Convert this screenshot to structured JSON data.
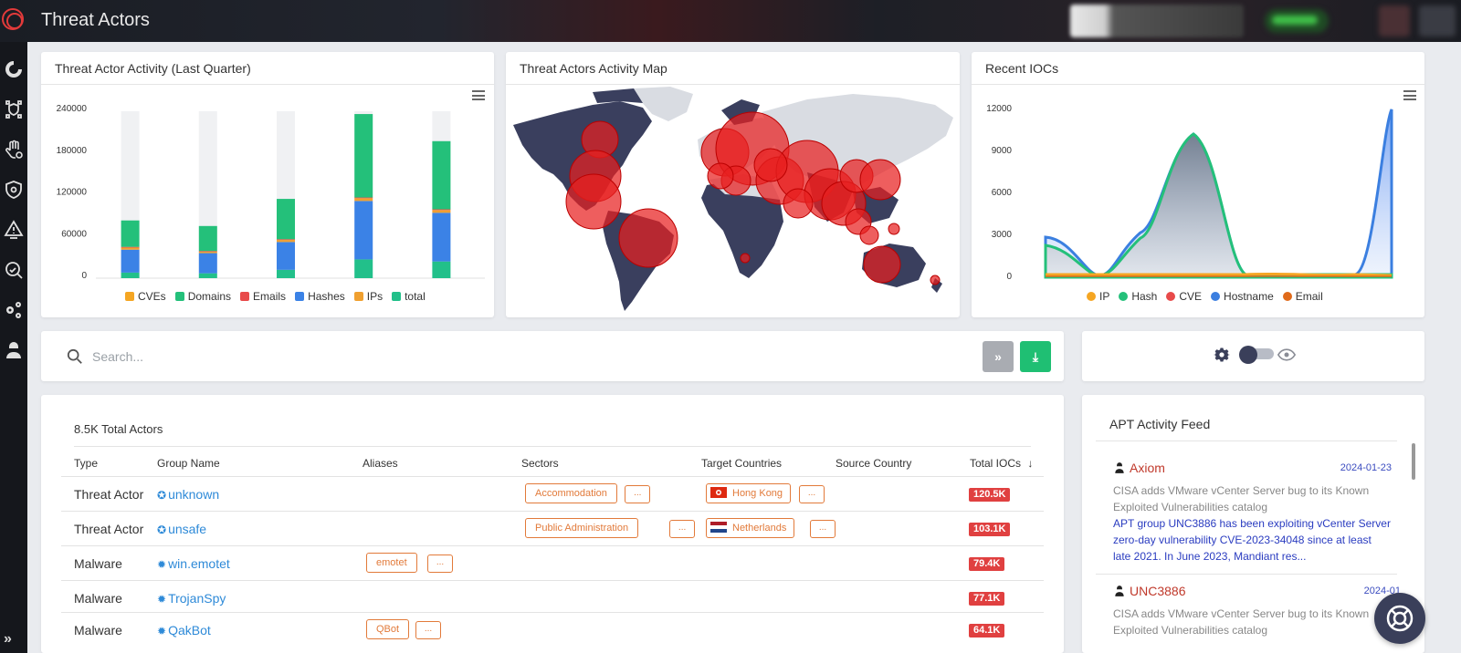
{
  "app": {
    "title": "Threat Actors"
  },
  "charts": {
    "activity": {
      "title": "Threat Actor Activity (Last Quarter)",
      "chart_data": {
        "type": "bar",
        "stacked": true,
        "categories": [
          "",
          "",
          "",
          "",
          ""
        ],
        "y_ticks": [
          "240000",
          "180000",
          "120000",
          "60000",
          "0"
        ],
        "ylim": [
          0,
          240000
        ],
        "series": [
          {
            "name": "CVEs",
            "color": "#f5a623",
            "values": [
              0,
              0,
              0,
              0,
              0
            ]
          },
          {
            "name": "Domains",
            "color": "#24c07a",
            "values": [
              38000,
              36000,
              58000,
              120000,
              98000
            ]
          },
          {
            "name": "Emails",
            "color": "#e84a4a",
            "values": [
              1000,
              1000,
              1000,
              1000,
              1000
            ]
          },
          {
            "name": "Hashes",
            "color": "#3b82e6",
            "values": [
              33000,
              29000,
              40000,
              84000,
              70000
            ]
          },
          {
            "name": "IPs",
            "color": "#f0a030",
            "values": [
              3000,
              2000,
              3000,
              4000,
              4000
            ]
          },
          {
            "name": "total",
            "color": "#22c08a",
            "values": [
              8000,
              7000,
              12000,
              27000,
              24000
            ]
          }
        ],
        "background_totals": [
          240000,
          240000,
          240000,
          240000,
          240000
        ],
        "legend": "bottom"
      }
    },
    "map": {
      "title": "Threat Actors Activity Map"
    },
    "iocs": {
      "title": "Recent IOCs",
      "chart_data": {
        "type": "area",
        "y_ticks": [
          "12000",
          "9000",
          "6000",
          "3000",
          "0"
        ],
        "ylim": [
          0,
          12000
        ],
        "series": [
          {
            "name": "IP",
            "color": "#f5a623"
          },
          {
            "name": "Hash",
            "color": "#24c07a"
          },
          {
            "name": "CVE",
            "color": "#e84a4a"
          },
          {
            "name": "Hostname",
            "color": "#3b7fe0"
          },
          {
            "name": "Email",
            "color": "#e06a1a"
          }
        ],
        "legend": "bottom"
      }
    }
  },
  "search": {
    "placeholder": "Search...",
    "forward_label": "»",
    "download_label": "⤓"
  },
  "table": {
    "total_label": "8.5K Total Actors",
    "headers": {
      "type": "Type",
      "group": "Group Name",
      "aliases": "Aliases",
      "sectors": "Sectors",
      "targets": "Target Countries",
      "source": "Source Country",
      "iocs": "Total IOCs"
    },
    "rows": [
      {
        "type": "Threat Actor",
        "name": "unknown",
        "alias": "",
        "sector": "Accommodation",
        "target": "Hong Kong",
        "target_flag": "hk",
        "iocs": "120.5K",
        "kind": "actor"
      },
      {
        "type": "Threat Actor",
        "name": "unsafe",
        "alias": "",
        "sector": "Public Administration",
        "target": "Netherlands",
        "target_flag": "nl",
        "iocs": "103.1K",
        "kind": "actor"
      },
      {
        "type": "Malware",
        "name": "win.emotet",
        "alias": "emotet",
        "sector": "",
        "target": "",
        "target_flag": "",
        "iocs": "79.4K",
        "kind": "malware"
      },
      {
        "type": "Malware",
        "name": "TrojanSpy",
        "alias": "",
        "sector": "",
        "target": "",
        "target_flag": "",
        "iocs": "77.1K",
        "kind": "malware"
      },
      {
        "type": "Malware",
        "name": "QakBot",
        "alias": "QBot",
        "sector": "",
        "target": "",
        "target_flag": "",
        "iocs": "64.1K",
        "kind": "malware"
      }
    ],
    "more_label": "..."
  },
  "feed": {
    "title": "APT Activity Feed",
    "items": [
      {
        "actor": "Axiom",
        "date": "2024-01-23",
        "subtitle": "CISA adds VMware vCenter Server bug to its Known Exploited Vulnerabilities catalog",
        "body": "APT group  UNC3886  has been exploiting vCenter Server zero-day vulnerability  CVE-2023-34048  since at least late 2021. In June 2023, Mandiant res..."
      },
      {
        "actor": "UNC3886",
        "date": "2024-01",
        "subtitle": "CISA adds VMware vCenter Server bug to its Known Exploited Vulnerabilities catalog",
        "body": ""
      }
    ]
  },
  "colors": {
    "accent_red": "#e04040",
    "link_blue": "#2e8ad8",
    "tag_orange": "#e27a3a",
    "download_green": "#1fbf73",
    "forward_gray": "#a9acb2",
    "map_land": "#3a3f5e",
    "map_land_light": "#d9dce2",
    "map_bubble": "#e82020"
  }
}
